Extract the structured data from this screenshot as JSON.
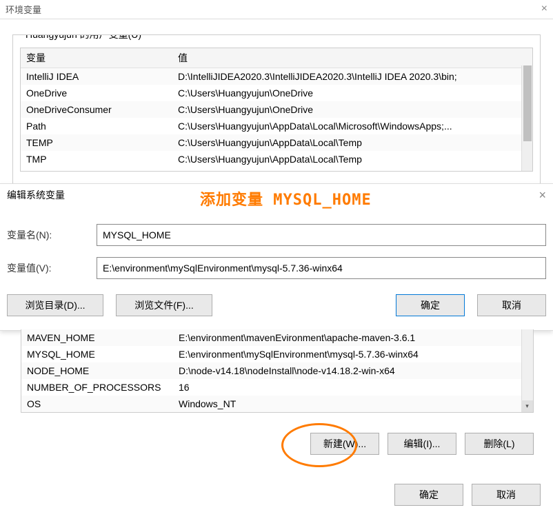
{
  "backWindow": {
    "title": "环境变量"
  },
  "userVars": {
    "groupTitle": "Huangyujun 的用户变量(U)",
    "columns": {
      "var": "变量",
      "val": "值"
    },
    "rows": [
      {
        "var": "IntelliJ IDEA",
        "val": "D:\\IntelliJIDEA2020.3\\IntelliJIDEA2020.3\\IntelliJ IDEA 2020.3\\bin;"
      },
      {
        "var": "OneDrive",
        "val": "C:\\Users\\Huangyujun\\OneDrive"
      },
      {
        "var": "OneDriveConsumer",
        "val": "C:\\Users\\Huangyujun\\OneDrive"
      },
      {
        "var": "Path",
        "val": "C:\\Users\\Huangyujun\\AppData\\Local\\Microsoft\\WindowsApps;..."
      },
      {
        "var": "TEMP",
        "val": "C:\\Users\\Huangyujun\\AppData\\Local\\Temp"
      },
      {
        "var": "TMP",
        "val": "C:\\Users\\Huangyujun\\AppData\\Local\\Temp"
      }
    ]
  },
  "editDialog": {
    "title": "编辑系统变量",
    "annotation": "添加变量 MYSQL_HOME",
    "nameLabel": "变量名(N):",
    "nameValue": "MYSQL_HOME",
    "valueLabel": "变量值(V):",
    "valueValue": "E:\\environment\\mySqlEnvironment\\mysql-5.7.36-winx64",
    "browseDir": "浏览目录(D)...",
    "browseFile": "浏览文件(F)...",
    "ok": "确定",
    "cancel": "取消"
  },
  "sysVars": {
    "rows": [
      {
        "var": "MAVEN_HOME",
        "val": "E:\\environment\\mavenEvironment\\apache-maven-3.6.1"
      },
      {
        "var": "MYSQL_HOME",
        "val": "E:\\environment\\mySqlEnvironment\\mysql-5.7.36-winx64"
      },
      {
        "var": "NODE_HOME",
        "val": "D:\\node-v14.18\\nodeInstall\\node-v14.18.2-win-x64"
      },
      {
        "var": "NUMBER_OF_PROCESSORS",
        "val": "16"
      },
      {
        "var": "OS",
        "val": "Windows_NT"
      }
    ],
    "new": "新建(W)...",
    "edit": "编辑(I)...",
    "delete": "删除(L)"
  },
  "outer": {
    "ok": "确定",
    "cancel": "取消"
  }
}
